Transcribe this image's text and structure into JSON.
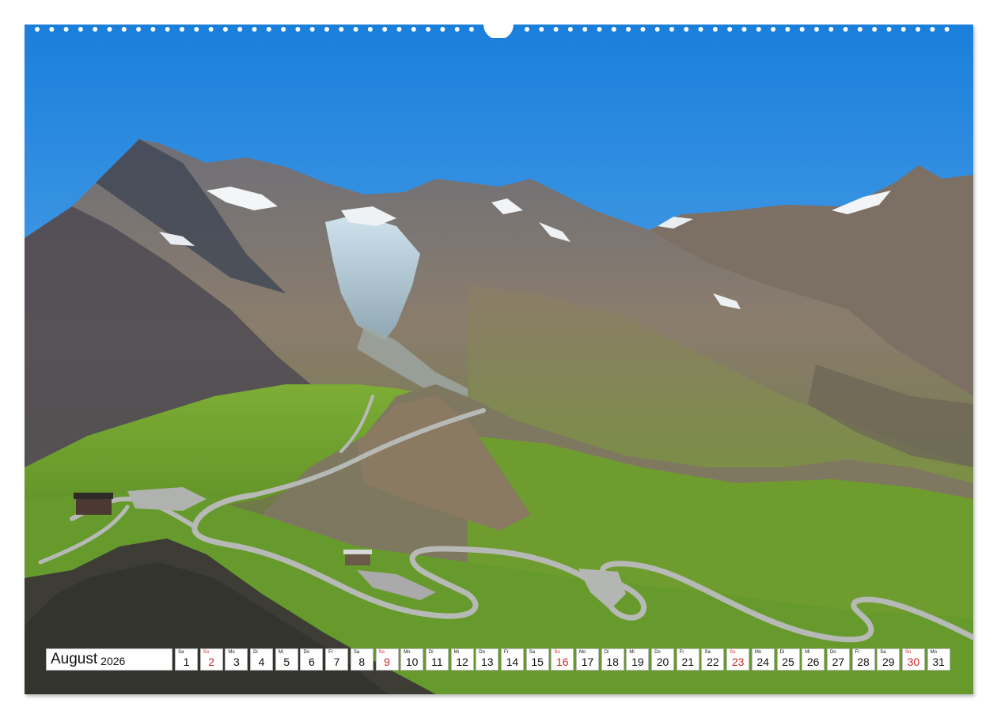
{
  "calendar": {
    "month": "August",
    "year": "2026",
    "days": [
      {
        "wd": "Sa",
        "n": "1",
        "sunday": false
      },
      {
        "wd": "So",
        "n": "2",
        "sunday": true
      },
      {
        "wd": "Mo",
        "n": "3",
        "sunday": false
      },
      {
        "wd": "Di",
        "n": "4",
        "sunday": false
      },
      {
        "wd": "Mi",
        "n": "5",
        "sunday": false
      },
      {
        "wd": "Do",
        "n": "6",
        "sunday": false
      },
      {
        "wd": "Fr",
        "n": "7",
        "sunday": false
      },
      {
        "wd": "Sa",
        "n": "8",
        "sunday": false
      },
      {
        "wd": "So",
        "n": "9",
        "sunday": true
      },
      {
        "wd": "Mo",
        "n": "10",
        "sunday": false
      },
      {
        "wd": "Di",
        "n": "11",
        "sunday": false
      },
      {
        "wd": "Mi",
        "n": "12",
        "sunday": false
      },
      {
        "wd": "Do",
        "n": "13",
        "sunday": false
      },
      {
        "wd": "Fr",
        "n": "14",
        "sunday": false
      },
      {
        "wd": "Sa",
        "n": "15",
        "sunday": false
      },
      {
        "wd": "So",
        "n": "16",
        "sunday": true
      },
      {
        "wd": "Mo",
        "n": "17",
        "sunday": false
      },
      {
        "wd": "Di",
        "n": "18",
        "sunday": false
      },
      {
        "wd": "Mi",
        "n": "19",
        "sunday": false
      },
      {
        "wd": "Do",
        "n": "20",
        "sunday": false
      },
      {
        "wd": "Fr",
        "n": "21",
        "sunday": false
      },
      {
        "wd": "Sa",
        "n": "22",
        "sunday": false
      },
      {
        "wd": "So",
        "n": "23",
        "sunday": true
      },
      {
        "wd": "Mo",
        "n": "24",
        "sunday": false
      },
      {
        "wd": "Di",
        "n": "25",
        "sunday": false
      },
      {
        "wd": "Mi",
        "n": "26",
        "sunday": false
      },
      {
        "wd": "Do",
        "n": "27",
        "sunday": false
      },
      {
        "wd": "Fr",
        "n": "28",
        "sunday": false
      },
      {
        "wd": "Sa",
        "n": "29",
        "sunday": false
      },
      {
        "wd": "So",
        "n": "30",
        "sunday": true
      },
      {
        "wd": "Mo",
        "n": "31",
        "sunday": false
      }
    ]
  },
  "colors": {
    "sky_top": "#1f86df",
    "sky_bottom": "#8cc6ef",
    "sunday_red": "#d0262c",
    "meadow_green": "#6f9e2c",
    "rock_brown": "#7a6a58",
    "road_grey": "#b9b9b9"
  }
}
